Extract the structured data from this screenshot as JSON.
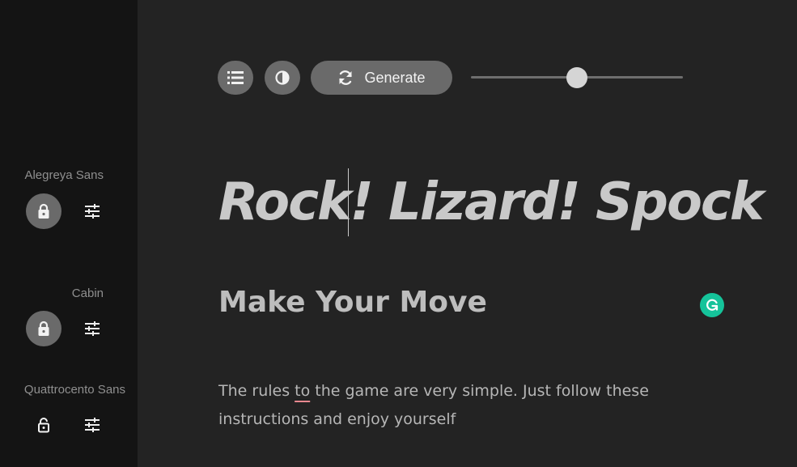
{
  "sidebar": {
    "fonts": [
      {
        "name": "Alegreya Sans",
        "lock_icon": "lock-icon",
        "tune_icon": "tune-icon"
      },
      {
        "name": "Cabin",
        "lock_icon": "lock-icon",
        "tune_icon": "tune-icon"
      },
      {
        "name": "Quattrocento Sans",
        "lock_icon": "lock-open-icon",
        "tune_icon": "tune-icon"
      }
    ]
  },
  "toolbar": {
    "list_icon": "list-icon",
    "contrast_icon": "contrast-icon",
    "generate_icon": "refresh-icon",
    "generate_label": "Generate",
    "slider_value": 0.5
  },
  "content": {
    "headline": "Rock! Lizard! Spock",
    "subheading": "Make Your Move",
    "paragraph_before": "The rules ",
    "paragraph_flagged": "to",
    "paragraph_after": " the game are very simple. Just follow these instructions and enjoy yourself"
  },
  "colors": {
    "background": "#232323",
    "sidebar": "#141414",
    "button": "#6a6a6a",
    "grammarly": "#15c39a",
    "spell_underline": "#e8888f"
  }
}
